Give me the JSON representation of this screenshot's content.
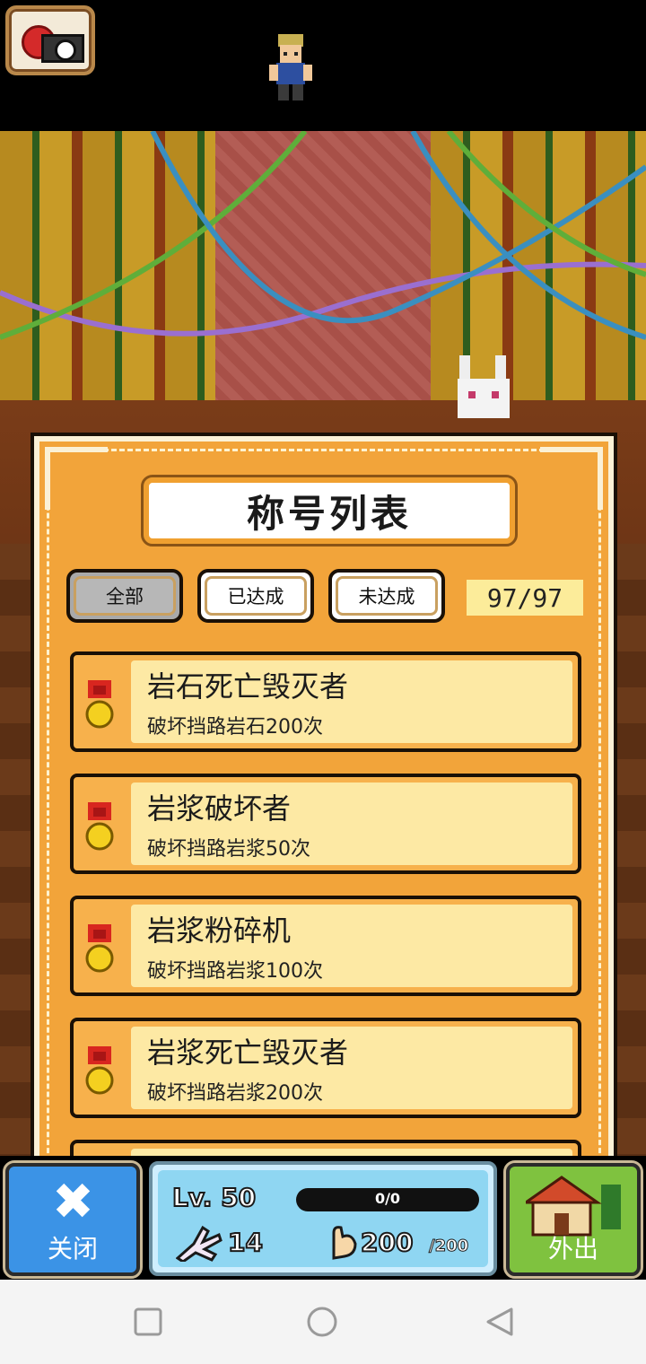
{
  "dialog": {
    "title": "称号列表",
    "tabs": [
      {
        "label": "全部",
        "selected": true
      },
      {
        "label": "已达成",
        "selected": false
      },
      {
        "label": "未达成",
        "selected": false
      }
    ],
    "count": "97/97"
  },
  "titles": [
    {
      "name": "岩石死亡毁灭者",
      "desc": "破坏挡路岩石200次"
    },
    {
      "name": "岩浆破坏者",
      "desc": "破坏挡路岩浆50次"
    },
    {
      "name": "岩浆粉碎机",
      "desc": "破坏挡路岩浆100次"
    },
    {
      "name": "岩浆死亡毁灭者",
      "desc": "破坏挡路岩浆200次"
    }
  ],
  "hud": {
    "close_label": "关闭",
    "close_glyph": "✖",
    "level": "Lv. 50",
    "xp": "0/0",
    "paw_count": "14",
    "strength": "200",
    "strength_max": "/200",
    "out_label": "外出"
  },
  "colors": {
    "panel": "#f2a43a",
    "item_bg": "#fde9a4",
    "close_btn": "#3b93e6",
    "out_btn": "#7fc23f"
  },
  "icons": [
    "camera-icon",
    "medal-icon",
    "close-x-icon",
    "paw-icon",
    "muscle-arm-icon",
    "house-icon",
    "nav-square-icon",
    "nav-circle-icon",
    "nav-back-icon"
  ]
}
